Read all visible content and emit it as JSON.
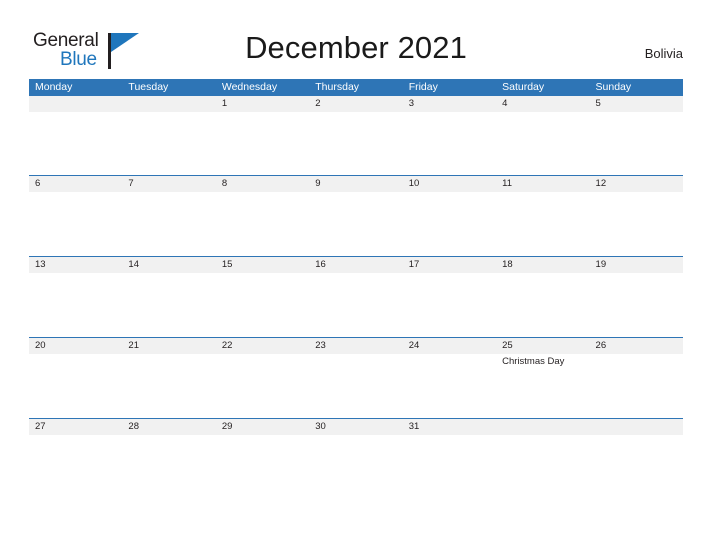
{
  "header": {
    "logo": {
      "line1": "General",
      "line2": "Blue",
      "flag_icon": "blue-triangle-flag-icon"
    },
    "title": "December 2021",
    "locale": "Bolivia"
  },
  "calendar": {
    "weekdays": [
      "Monday",
      "Tuesday",
      "Wednesday",
      "Thursday",
      "Friday",
      "Saturday",
      "Sunday"
    ],
    "colors": {
      "header_blue": "#2e75b6",
      "band_gray": "#f1f1f1",
      "text": "#231f20",
      "logo_blue": "#1f76bc"
    },
    "weeks": [
      {
        "days": [
          {
            "date": "",
            "event": ""
          },
          {
            "date": "",
            "event": ""
          },
          {
            "date": "1",
            "event": ""
          },
          {
            "date": "2",
            "event": ""
          },
          {
            "date": "3",
            "event": ""
          },
          {
            "date": "4",
            "event": ""
          },
          {
            "date": "5",
            "event": ""
          }
        ]
      },
      {
        "days": [
          {
            "date": "6",
            "event": ""
          },
          {
            "date": "7",
            "event": ""
          },
          {
            "date": "8",
            "event": ""
          },
          {
            "date": "9",
            "event": ""
          },
          {
            "date": "10",
            "event": ""
          },
          {
            "date": "11",
            "event": ""
          },
          {
            "date": "12",
            "event": ""
          }
        ]
      },
      {
        "days": [
          {
            "date": "13",
            "event": ""
          },
          {
            "date": "14",
            "event": ""
          },
          {
            "date": "15",
            "event": ""
          },
          {
            "date": "16",
            "event": ""
          },
          {
            "date": "17",
            "event": ""
          },
          {
            "date": "18",
            "event": ""
          },
          {
            "date": "19",
            "event": ""
          }
        ]
      },
      {
        "days": [
          {
            "date": "20",
            "event": ""
          },
          {
            "date": "21",
            "event": ""
          },
          {
            "date": "22",
            "event": ""
          },
          {
            "date": "23",
            "event": ""
          },
          {
            "date": "24",
            "event": ""
          },
          {
            "date": "25",
            "event": "Christmas Day"
          },
          {
            "date": "26",
            "event": ""
          }
        ]
      },
      {
        "days": [
          {
            "date": "27",
            "event": ""
          },
          {
            "date": "28",
            "event": ""
          },
          {
            "date": "29",
            "event": ""
          },
          {
            "date": "30",
            "event": ""
          },
          {
            "date": "31",
            "event": ""
          },
          {
            "date": "",
            "event": ""
          },
          {
            "date": "",
            "event": ""
          }
        ]
      }
    ]
  }
}
